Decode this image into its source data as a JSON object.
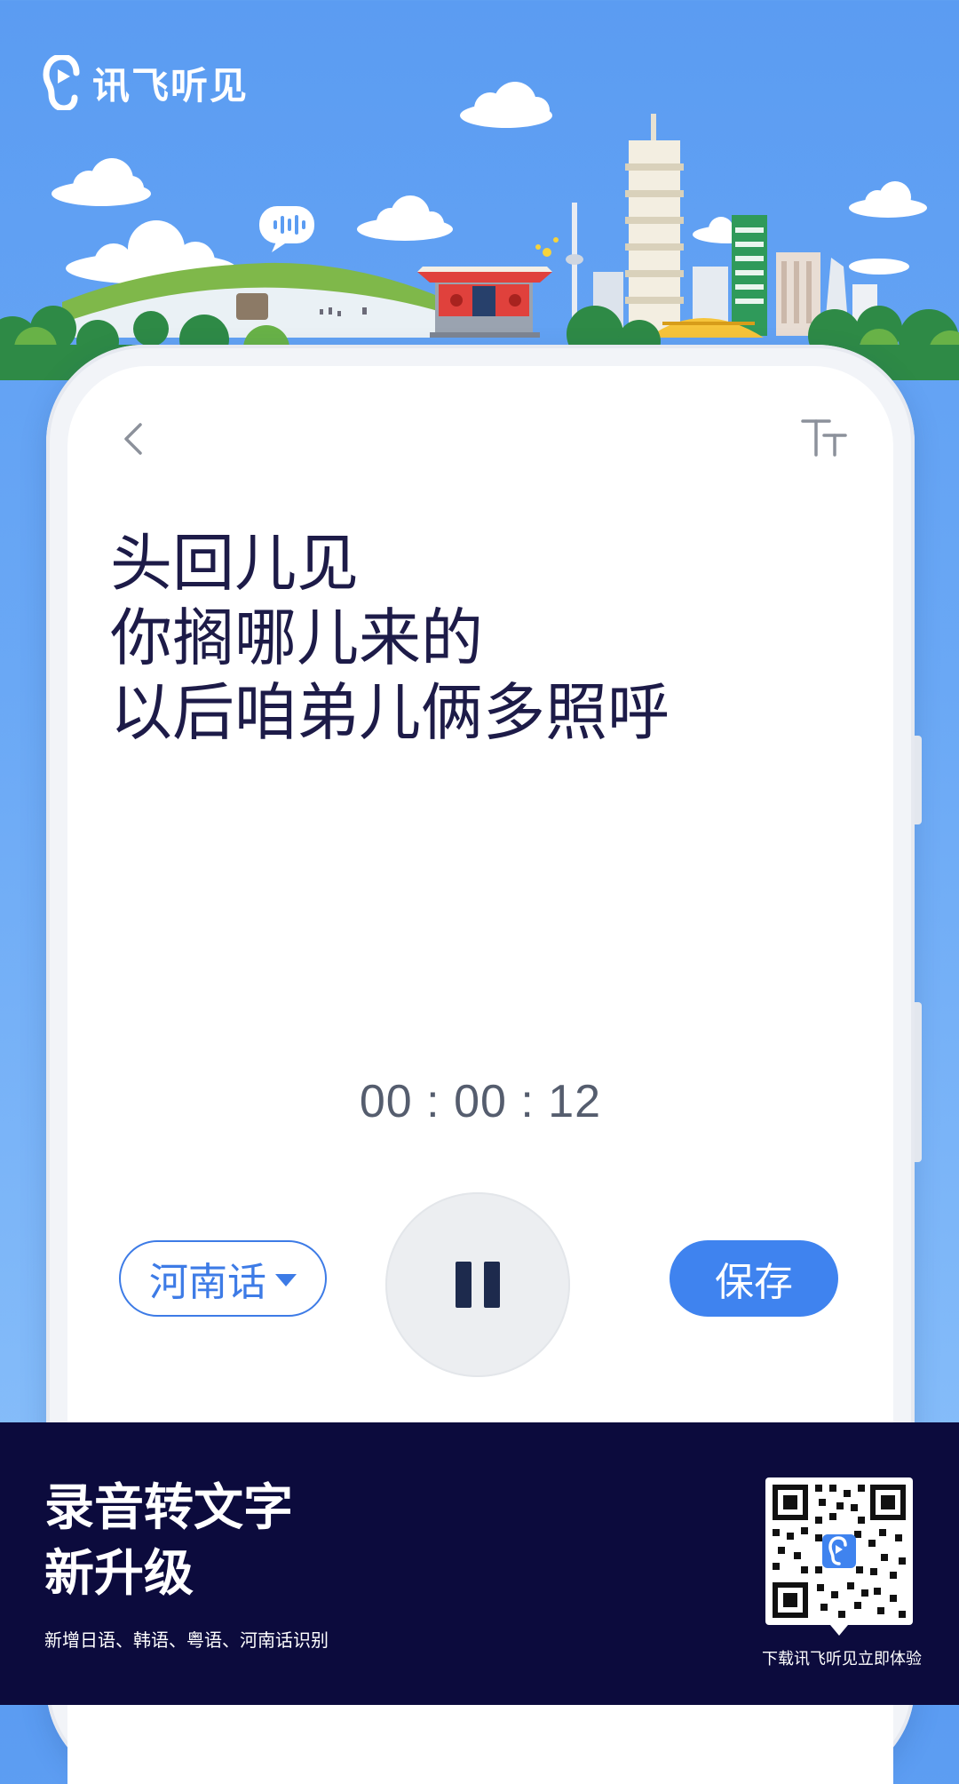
{
  "brand": {
    "name": "讯飞听见"
  },
  "toolbar": {
    "back_icon": "chevron-left-icon",
    "font_size_icon": "font-size-icon"
  },
  "transcript": {
    "lines": [
      "头回儿见",
      "你搁哪儿来的",
      "以后咱弟儿俩多照呼"
    ]
  },
  "recorder": {
    "timer": "00 : 00 : 12",
    "dialect_label": "河南话",
    "save_label": "保存",
    "state": "recording"
  },
  "footer": {
    "headline_line1": "录音转文字",
    "headline_line2": "新升级",
    "subtitle": "新增日语、韩语、粤语、河南话识别",
    "qr_caption": "下载讯飞听见立即体验"
  },
  "colors": {
    "sky_top": "#5b9cf2",
    "accent": "#3f83ef",
    "footer_bg": "#0c0b3d",
    "text_dark": "#1d1b48"
  }
}
